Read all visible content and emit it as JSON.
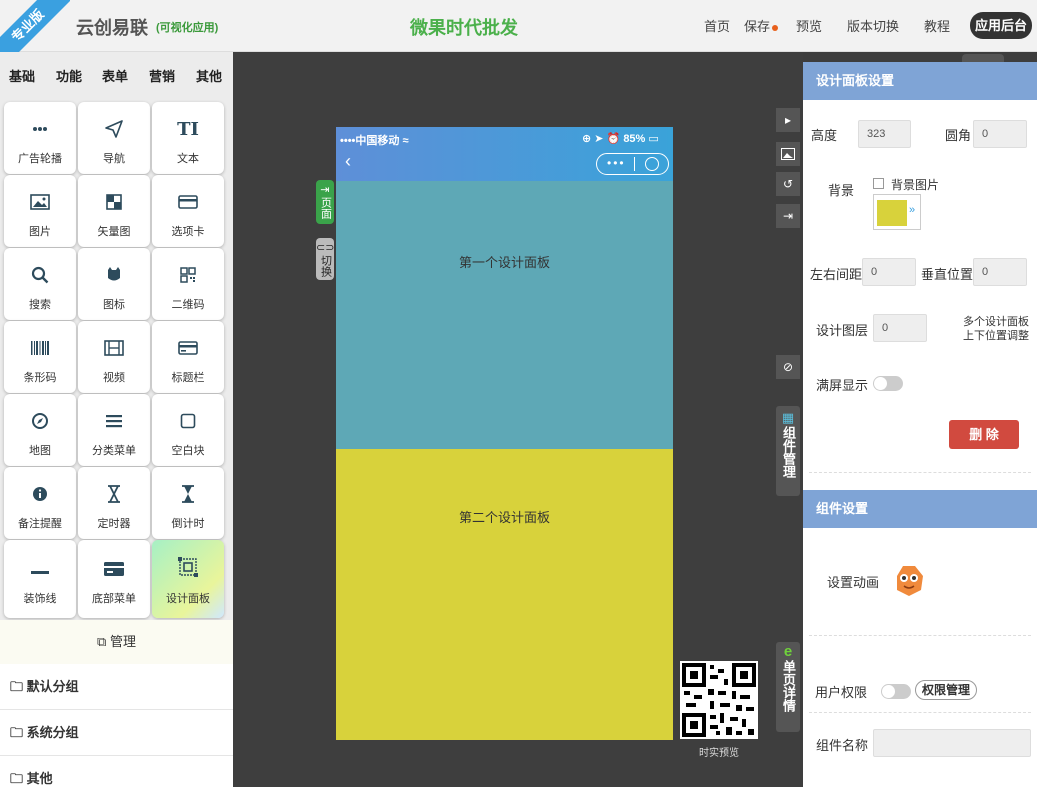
{
  "header": {
    "ribbon": "专业版",
    "brand": "云创易联",
    "brand_sub": "(可视化应用)",
    "center_title": "微果时代批发",
    "nav": [
      "首页",
      "保存",
      "预览",
      "版本切换",
      "教程"
    ],
    "app_button": "应用后台"
  },
  "left": {
    "tabs": [
      "基础",
      "功能",
      "表单",
      "营销",
      "其他"
    ],
    "components": [
      "广告轮播",
      "导航",
      "文本",
      "图片",
      "矢量图",
      "选项卡",
      "搜索",
      "图标",
      "二维码",
      "条形码",
      "视频",
      "标题栏",
      "地图",
      "分类菜单",
      "空白块",
      "备注提醒",
      "定时器",
      "倒计时",
      "装饰线",
      "底部菜单",
      "设计面板"
    ],
    "manage": "管理",
    "groups": [
      "默认分组",
      "系统分组",
      "其他"
    ]
  },
  "canvas": {
    "carrier": "中国移动",
    "battery": "85%",
    "tag_page": "页面",
    "tag_switch": "切换",
    "panel1_label": "第一个设计面板",
    "panel2_label": "第二个设计面板",
    "qr_label": "时实预览"
  },
  "strip": {
    "component_manage": "组件管理",
    "page_detail": "单页详情"
  },
  "right": {
    "section1": "设计面板设置",
    "height_label": "高度",
    "height_value": "323",
    "radius_label": "圆角",
    "radius_value": "0",
    "bg_label": "背景",
    "bg_image_label": "背景图片",
    "bg_color": "#d8d23b",
    "lr_label": "左右间距",
    "lr_value": "0",
    "v_label": "垂直位置",
    "v_value": "0",
    "layer_label": "设计图层",
    "layer_value": "0",
    "layer_hint1": "多个设计面板",
    "layer_hint2": "上下位置调整",
    "fullscreen_label": "满屏显示",
    "delete_label": "删 除",
    "section2": "组件设置",
    "anim_label": "设置动画",
    "perm_label": "用户权限",
    "perm_button": "权限管理",
    "name_label": "组件名称"
  }
}
